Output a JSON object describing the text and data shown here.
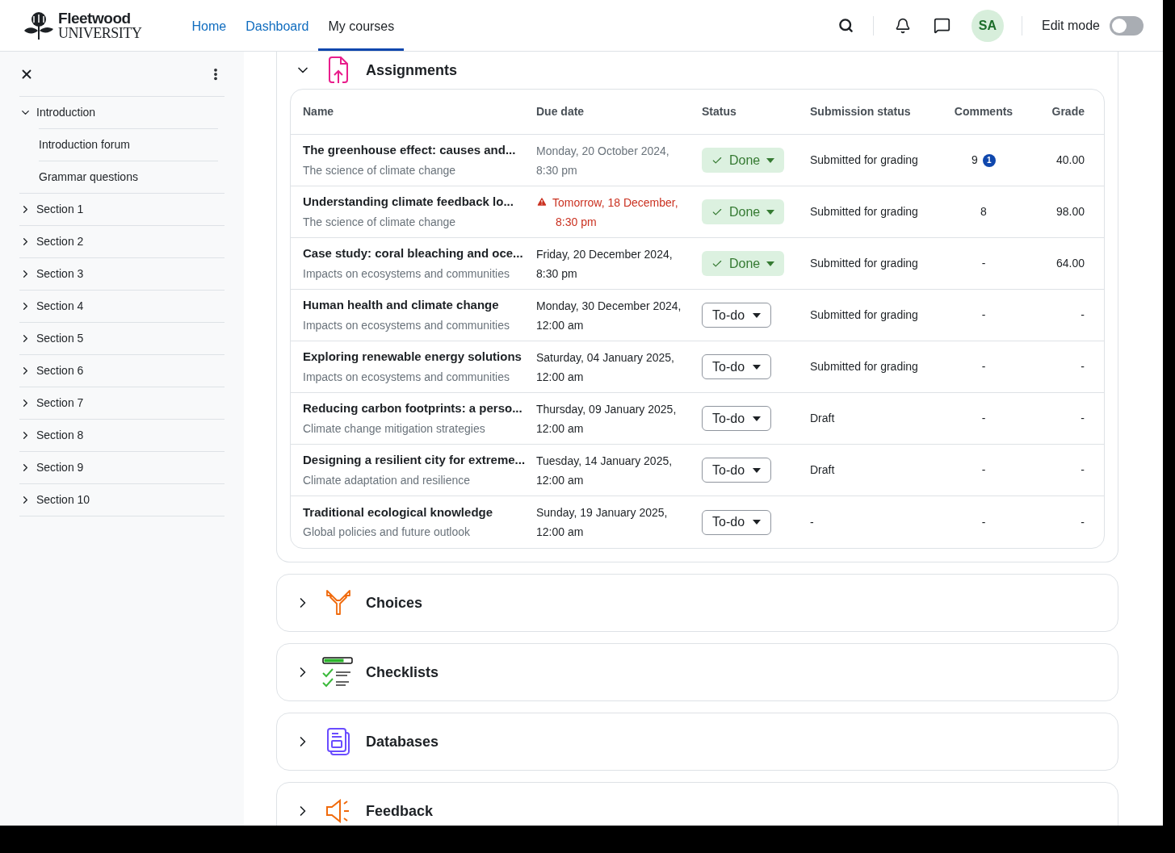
{
  "header": {
    "logo": {
      "name": "Fleetwood",
      "subtitle": "UNIVERSITY"
    },
    "nav": [
      {
        "label": "Home",
        "selected": false
      },
      {
        "label": "Dashboard",
        "selected": false
      },
      {
        "label": "My courses",
        "selected": true
      }
    ],
    "avatar": "SA",
    "edit_mode": {
      "label": "Edit mode",
      "on": false
    }
  },
  "sidebar": {
    "items": [
      {
        "label": "Introduction",
        "expanded": true,
        "children": [
          {
            "label": "Introduction forum"
          },
          {
            "label": "Grammar questions"
          }
        ]
      },
      {
        "label": "Section 1",
        "expanded": false
      },
      {
        "label": "Section 2",
        "expanded": false
      },
      {
        "label": "Section 3",
        "expanded": false
      },
      {
        "label": "Section 4",
        "expanded": false
      },
      {
        "label": "Section 5",
        "expanded": false
      },
      {
        "label": "Section 6",
        "expanded": false
      },
      {
        "label": "Section 7",
        "expanded": false
      },
      {
        "label": "Section 8",
        "expanded": false
      },
      {
        "label": "Section 9",
        "expanded": false
      },
      {
        "label": "Section 10",
        "expanded": false
      }
    ]
  },
  "sections": [
    {
      "title": "Assignments",
      "kind": "assignment",
      "expanded": true,
      "table": {
        "columns": [
          "Name",
          "Due date",
          "Status",
          "Submission status",
          "Comments",
          "Grade"
        ],
        "rows": [
          {
            "name": "The greenhouse effect: causes and...",
            "topic": "The science of climate change",
            "due": [
              "Monday, 20 October 2024,",
              "8:30 pm"
            ],
            "past": true,
            "warning": false,
            "status": {
              "label": "Done",
              "kind": "done"
            },
            "submission": "Submitted for grading",
            "comments": "9",
            "comments_badge": "1",
            "grade": "40.00"
          },
          {
            "name": "Understanding climate feedback lo...",
            "topic": "The science of climate change",
            "due": [
              "Tomorrow, 18 December,",
              "8:30 pm"
            ],
            "past": false,
            "warning": true,
            "status": {
              "label": "Done",
              "kind": "done"
            },
            "submission": "Submitted for grading",
            "comments": "8",
            "grade": "98.00"
          },
          {
            "name": "Case study: coral bleaching and oce...",
            "topic": "Impacts on ecosystems and communities",
            "due": [
              "Friday, 20 December 2024,",
              "8:30 pm"
            ],
            "past": false,
            "warning": false,
            "status": {
              "label": "Done",
              "kind": "done"
            },
            "submission": "Submitted for grading",
            "comments": "-",
            "grade": "64.00"
          },
          {
            "name": "Human health and climate change",
            "topic": "Impacts on ecosystems and communities",
            "due": [
              "Monday, 30 December 2024,",
              "12:00 am"
            ],
            "past": false,
            "warning": false,
            "status": {
              "label": "To-do",
              "kind": "todo"
            },
            "submission": "Submitted for grading",
            "comments": "-",
            "grade": "-"
          },
          {
            "name": "Exploring renewable energy solutions",
            "topic": "Impacts on ecosystems and communities",
            "due": [
              "Saturday, 04 January 2025,",
              "12:00 am"
            ],
            "past": false,
            "warning": false,
            "status": {
              "label": "To-do",
              "kind": "todo"
            },
            "submission": "Submitted for grading",
            "comments": "-",
            "grade": "-"
          },
          {
            "name": "Reducing carbon footprints: a perso...",
            "topic": "Climate change mitigation strategies",
            "due": [
              "Thursday, 09 January 2025,",
              "12:00 am"
            ],
            "past": false,
            "warning": false,
            "status": {
              "label": "To-do",
              "kind": "todo"
            },
            "submission": "Draft",
            "comments": "-",
            "grade": "-"
          },
          {
            "name": "Designing a resilient city for extreme...",
            "topic": "Climate adaptation and resilience",
            "due": [
              "Tuesday, 14 January 2025,",
              "12:00 am"
            ],
            "past": false,
            "warning": false,
            "status": {
              "label": "To-do",
              "kind": "todo"
            },
            "submission": "Draft",
            "comments": "-",
            "grade": "-"
          },
          {
            "name": "Traditional ecological knowledge",
            "topic": "Global policies and future outlook",
            "due": [
              "Sunday, 19 January 2025,",
              "12:00 am"
            ],
            "past": false,
            "warning": false,
            "status": {
              "label": "To-do",
              "kind": "todo"
            },
            "submission": "-",
            "comments": "-",
            "grade": "-"
          }
        ]
      }
    },
    {
      "title": "Choices",
      "kind": "choice",
      "expanded": false
    },
    {
      "title": "Checklists",
      "kind": "checklist",
      "expanded": false
    },
    {
      "title": "Databases",
      "kind": "database",
      "expanded": false
    },
    {
      "title": "Feedback",
      "kind": "feedback",
      "expanded": false
    }
  ]
}
